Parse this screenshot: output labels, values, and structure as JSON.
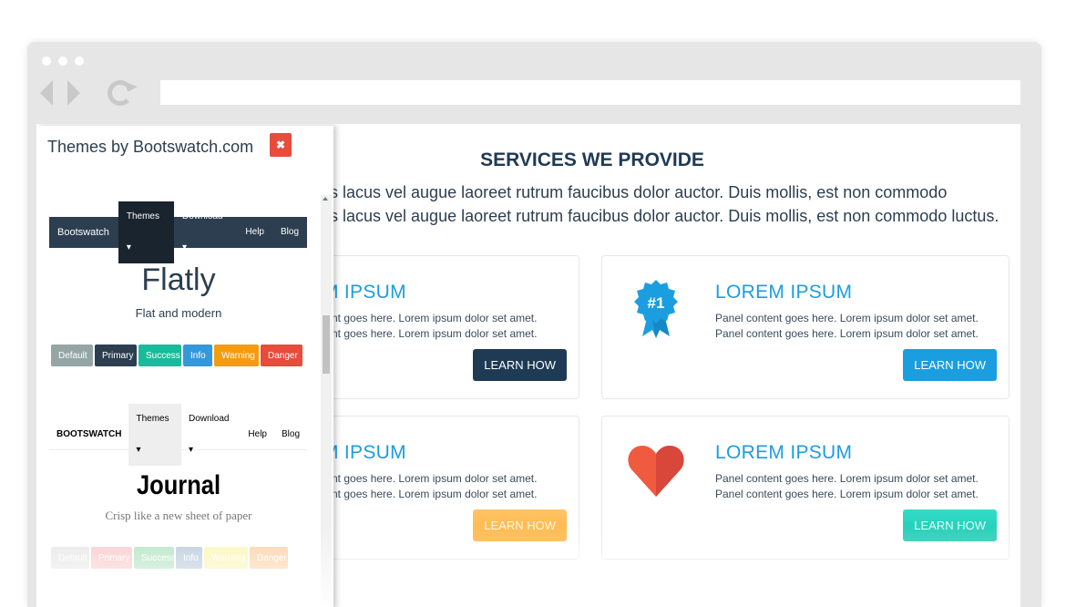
{
  "page": {
    "title": "SERVICES WE PROVIDE",
    "lead_line_1": "is lacus vel augue laoreet rutrum faucibus dolor auctor. Duis mollis, est non commodo",
    "lead_line_2": "is lacus vel augue laoreet rutrum faucibus dolor auctor. Duis mollis, est non commodo luctus."
  },
  "cards": [
    {
      "title": "M IPSUM",
      "line1": "tent goes here. Lorem ipsum dolor set amet.",
      "line2": "tent goes here. Lorem ipsum dolor set amet.",
      "button": "LEARN HOW",
      "button_color": "#1f3a54"
    },
    {
      "title": "LOREM IPSUM",
      "line1": "Panel content goes here. Lorem ipsum dolor set amet.",
      "line2": "Panel content goes here. Lorem ipsum dolor set amet.",
      "button": "LEARN HOW",
      "button_color": "#1a9ee0",
      "icon": "ribbon-badge-icon",
      "icon_text": "#1"
    },
    {
      "title": "M IPSUM",
      "line1": "tent goes here. Lorem ipsum dolor set amet.",
      "line2": "tent goes here. Lorem ipsum dolor set amet.",
      "button": "LEARN HOW",
      "button_color": "#ffb340"
    },
    {
      "title": "LOREM IPSUM",
      "line1": "Panel content goes here. Lorem ipsum dolor set amet.",
      "line2": "Panel content goes here. Lorem ipsum dolor set amet.",
      "button": "LEARN HOW",
      "button_color": "#18c6b0",
      "icon": "heart-icon"
    }
  ],
  "panel": {
    "title": "Themes by Bootswatch.com",
    "close_icon": "close-icon",
    "themes": [
      {
        "name": "Flatly",
        "description": "Flat and modern",
        "nav": {
          "brand": "Bootswatch",
          "items": [
            "Themes ▾",
            "Download ▾",
            "Help",
            "Blog"
          ]
        },
        "buttons": [
          {
            "label": "Default",
            "color": "#95a5a6"
          },
          {
            "label": "Primary",
            "color": "#2c3e50"
          },
          {
            "label": "Success",
            "color": "#18bc9c"
          },
          {
            "label": "Info",
            "color": "#3498db"
          },
          {
            "label": "Warning",
            "color": "#f39c12"
          },
          {
            "label": "Danger",
            "color": "#e74c3c"
          }
        ]
      },
      {
        "name": "Journal",
        "description": "Crisp like a new sheet of paper",
        "nav": {
          "brand": "BOOTSWATCH",
          "items": [
            "Themes ▾",
            "Download ▾",
            "Help",
            "Blog"
          ]
        },
        "buttons": [
          {
            "label": "Default",
            "color": "#bbbbbb"
          },
          {
            "label": "Primary",
            "color": "#eb6864"
          },
          {
            "label": "Success",
            "color": "#22b24c"
          },
          {
            "label": "Info",
            "color": "#336699"
          },
          {
            "label": "Warning",
            "color": "#f5e625"
          },
          {
            "label": "Danger",
            "color": "#f57a00"
          }
        ]
      }
    ]
  }
}
